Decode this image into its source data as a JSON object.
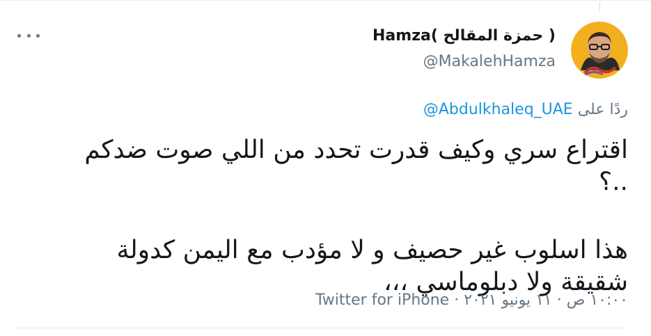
{
  "tweet": {
    "author": {
      "display_name": "( حمزة المقالح )Hamza",
      "handle": "@MakalehHamza",
      "avatar_icon": "user-avatar-photo"
    },
    "more_icon": "more-options-icon",
    "reply": {
      "prefix": "ردًا على",
      "mention": "@Abdulkhaleq_UAE"
    },
    "text": {
      "line1": "اقتراع سري وكيف قدرت تحدد من اللي صوت ضدكم ..؟",
      "line2": "هذا اسلوب غير حصيف و لا مؤدب مع اليمن كدولة",
      "line3": "شقيقة ولا دبلوماسي ،،،"
    },
    "meta": {
      "time": "١٠:٠٠ ص",
      "date": "١١ يونيو ٢٠٢١",
      "separator": "·",
      "source": "Twitter for iPhone"
    }
  },
  "colors": {
    "text": "#14171a",
    "secondary": "#657786",
    "link": "#1b95e0",
    "border": "#e6ecf0"
  }
}
